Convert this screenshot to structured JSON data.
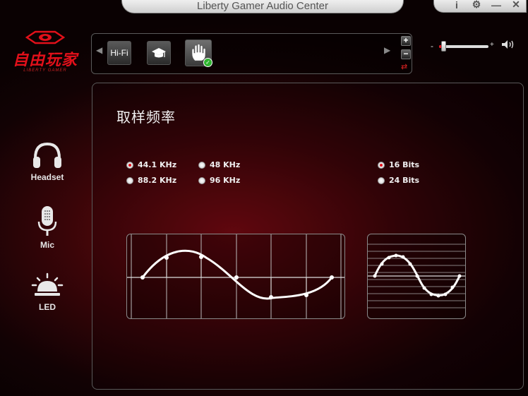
{
  "window": {
    "title": "Liberty Gamer Audio Center",
    "controls": {
      "info": "i",
      "settings": "⚙",
      "minimize": "—",
      "close": "✕"
    }
  },
  "logo": {
    "text": "自由玩家",
    "subtext": "LIBERTY GAMER"
  },
  "presets": {
    "items": [
      {
        "label": "Hi-Fi",
        "icon": "hifi-text"
      },
      {
        "label": "",
        "icon": "graduation-cap-icon"
      },
      {
        "label": "",
        "icon": "hand-icon",
        "active": true
      }
    ],
    "add": "+",
    "remove": "−",
    "swap": "⇄"
  },
  "volume": {
    "minus": "-",
    "plus": "+",
    "level": 0.1
  },
  "nav": {
    "headset": "Headset",
    "mic": "Mic",
    "led": "LED"
  },
  "panel": {
    "title": "取样频率",
    "sample_rates": [
      {
        "label": "44.1 KHz",
        "selected": true
      },
      {
        "label": "48 KHz",
        "selected": false
      },
      {
        "label": "88.2 KHz",
        "selected": false
      },
      {
        "label": "96 KHz",
        "selected": false
      }
    ],
    "bit_depths": [
      {
        "label": "16 Bits",
        "selected": true
      },
      {
        "label": "24 Bits",
        "selected": false
      }
    ]
  },
  "colors": {
    "accent": "#e2101a",
    "check": "#2fb52f"
  }
}
